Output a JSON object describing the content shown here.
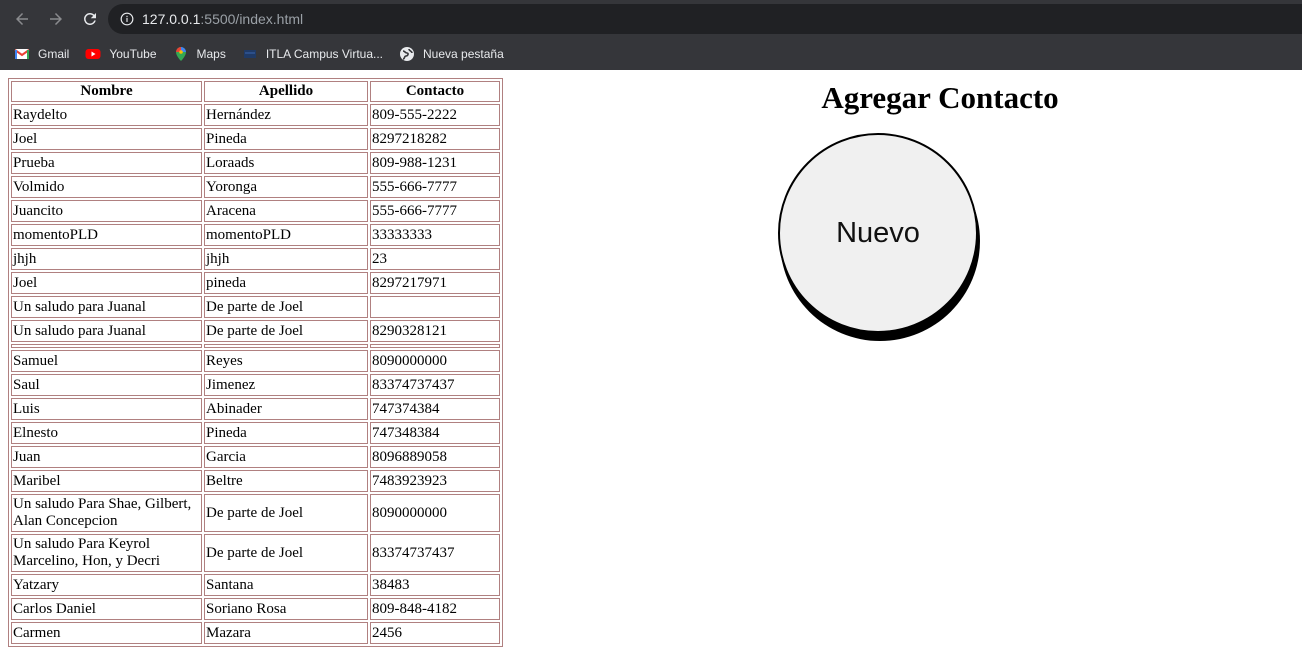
{
  "browser": {
    "url_host": "127.0.0.1",
    "url_rest": ":5500/index.html",
    "bookmarks": [
      {
        "label": "Gmail",
        "icon": "gmail-icon"
      },
      {
        "label": "YouTube",
        "icon": "youtube-icon"
      },
      {
        "label": "Maps",
        "icon": "maps-icon"
      },
      {
        "label": "ITLA Campus Virtua...",
        "icon": "itla-icon"
      },
      {
        "label": "Nueva pestaña",
        "icon": "globe-icon"
      }
    ]
  },
  "table": {
    "headers": [
      "Nombre",
      "Apellido",
      "Contacto"
    ],
    "rows": [
      [
        "Raydelto",
        "Hernández",
        "809-555-2222"
      ],
      [
        "Joel",
        "Pineda",
        "8297218282"
      ],
      [
        "Prueba",
        "Loraads",
        "809-988-1231"
      ],
      [
        "Volmido",
        "Yoronga",
        "555-666-7777"
      ],
      [
        "Juancito",
        "Aracena",
        "555-666-7777"
      ],
      [
        "momentoPLD",
        "momentoPLD",
        "33333333"
      ],
      [
        "jhjh",
        "jhjh",
        "23"
      ],
      [
        "Joel",
        "pineda",
        "8297217971"
      ],
      [
        "Un saludo para Juanal",
        "De parte de Joel",
        ""
      ],
      [
        "Un saludo para Juanal",
        "De parte de Joel",
        "8290328121"
      ],
      [
        "",
        "",
        ""
      ],
      [
        "Samuel",
        "Reyes",
        "8090000000"
      ],
      [
        "Saul",
        "Jimenez",
        "83374737437"
      ],
      [
        "Luis",
        "Abinader",
        "747374384"
      ],
      [
        "Elnesto",
        "Pineda",
        "747348384"
      ],
      [
        "Juan",
        "Garcia",
        "8096889058"
      ],
      [
        "Maribel",
        "Beltre",
        "7483923923"
      ],
      [
        "Un saludo Para Shae, Gilbert, Alan Concepcion",
        "De parte de Joel",
        "8090000000"
      ],
      [
        "Un saludo Para Keyrol Marcelino, Hon, y Decri",
        "De parte de Joel",
        "83374737437"
      ],
      [
        "Yatzary",
        "Santana",
        "38483"
      ],
      [
        "Carlos Daniel",
        "Soriano Rosa",
        "809-848-4182"
      ],
      [
        "Carmen",
        "Mazara",
        "2456"
      ]
    ]
  },
  "form": {
    "title": "Agregar Contacto",
    "new_button": "Nuevo"
  }
}
